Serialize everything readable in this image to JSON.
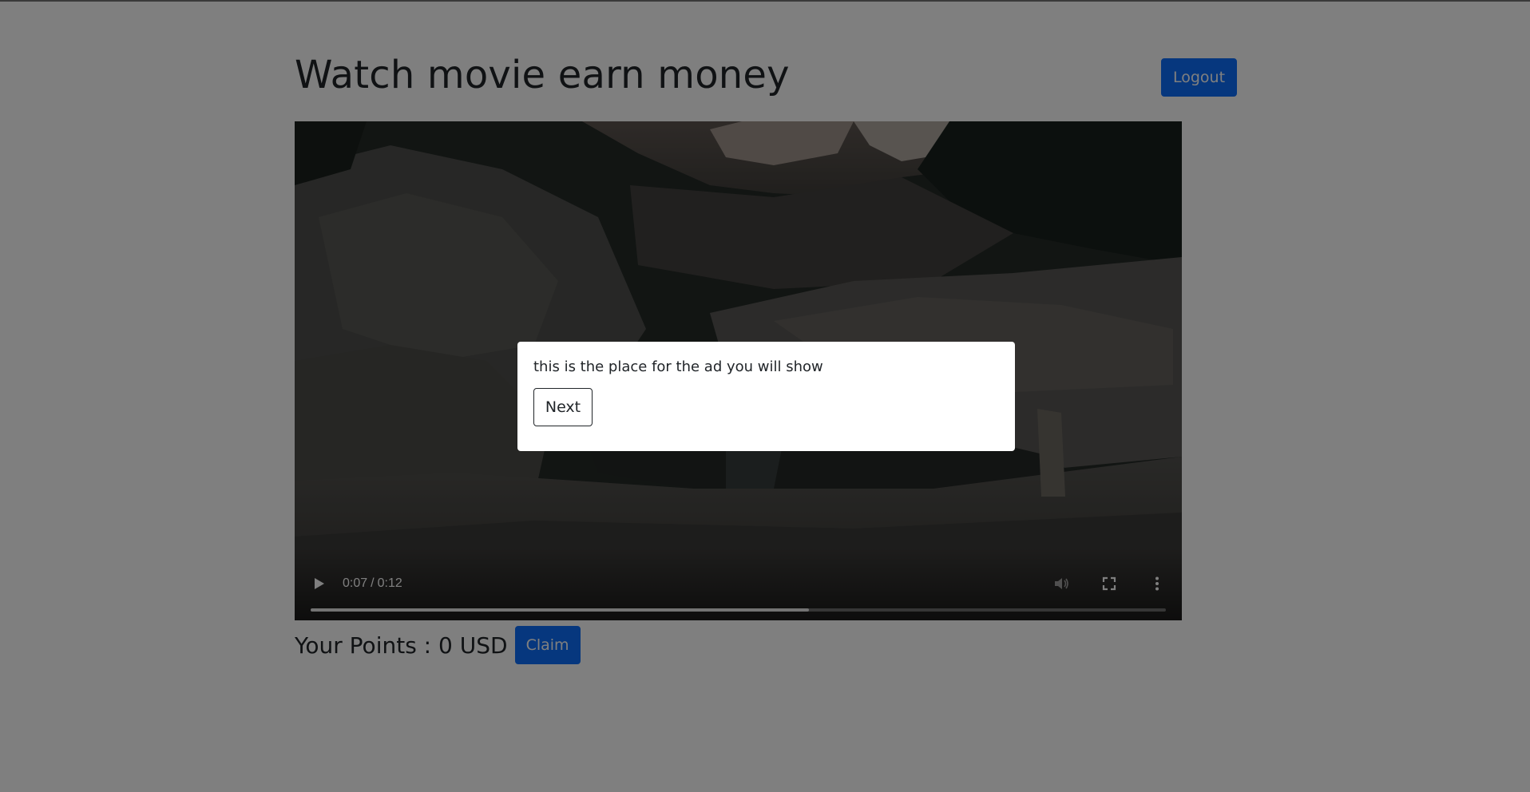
{
  "page": {
    "title": "Watch movie earn money"
  },
  "header": {
    "logout_label": "Logout"
  },
  "video": {
    "current_time": "0:07",
    "duration": "0:12",
    "time_separator": "/",
    "progress_fraction": 0.583
  },
  "points": {
    "label": "Your Points : 0 USD",
    "claim_label": "Claim"
  },
  "ad_modal": {
    "message": "this is the place for the ad you will show",
    "next_label": "Next"
  },
  "colors": {
    "primary": "#0d6efd",
    "text": "#212529",
    "overlay": "rgba(0,0,0,0.5)"
  },
  "icons": {
    "play": "play-icon",
    "mute": "volume-muted-icon",
    "fullscreen": "fullscreen-icon",
    "more": "more-vertical-icon"
  }
}
